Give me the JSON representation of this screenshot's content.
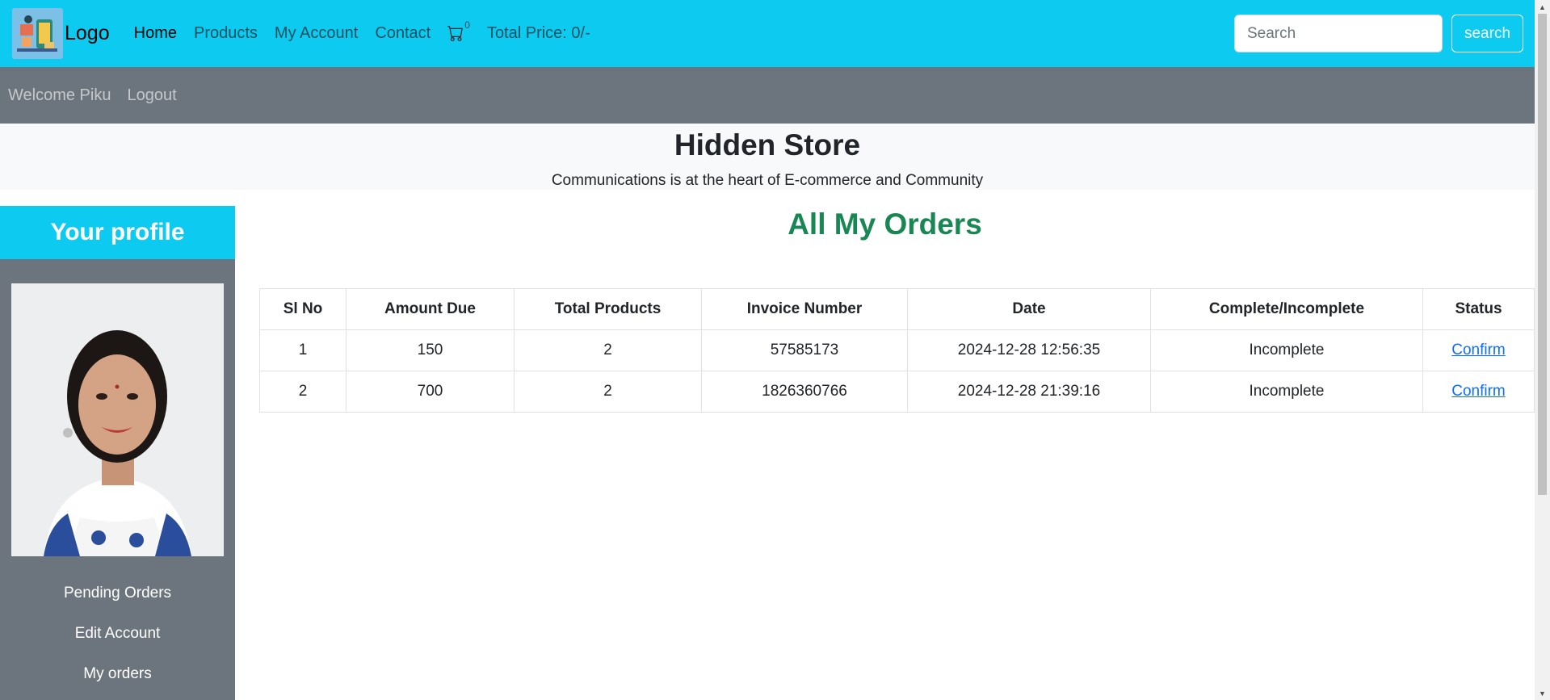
{
  "navbar": {
    "brand_text": "Logo",
    "links": [
      {
        "label": "Home",
        "active": true
      },
      {
        "label": "Products",
        "active": false
      },
      {
        "label": "My Account",
        "active": false
      },
      {
        "label": "Contact",
        "active": false
      }
    ],
    "cart_icon": "cart-icon",
    "cart_count": "0",
    "total_price": "Total Price: 0/-",
    "search_placeholder": "Search",
    "search_button": "search",
    "accent_color": "#0dcaf0"
  },
  "subbar": {
    "welcome": "Welcome Piku",
    "logout": "Logout",
    "bg_color": "#6c757d"
  },
  "hero": {
    "title": "Hidden Store",
    "subtitle": "Communications is at the heart of E-commerce and Community"
  },
  "sidebar": {
    "heading": "Your profile",
    "links": [
      "Pending Orders",
      "Edit Account",
      "My orders"
    ]
  },
  "orders": {
    "title": "All My Orders",
    "title_color": "#198754",
    "columns": [
      "Sl No",
      "Amount Due",
      "Total Products",
      "Invoice Number",
      "Date",
      "Complete/Incomplete",
      "Status"
    ],
    "rows": [
      [
        "1",
        "150",
        "2",
        "57585173",
        "2024-12-28 12:56:35",
        "Incomplete",
        "Confirm"
      ],
      [
        "2",
        "700",
        "2",
        "1826360766",
        "2024-12-28 21:39:16",
        "Incomplete",
        "Confirm"
      ]
    ]
  }
}
